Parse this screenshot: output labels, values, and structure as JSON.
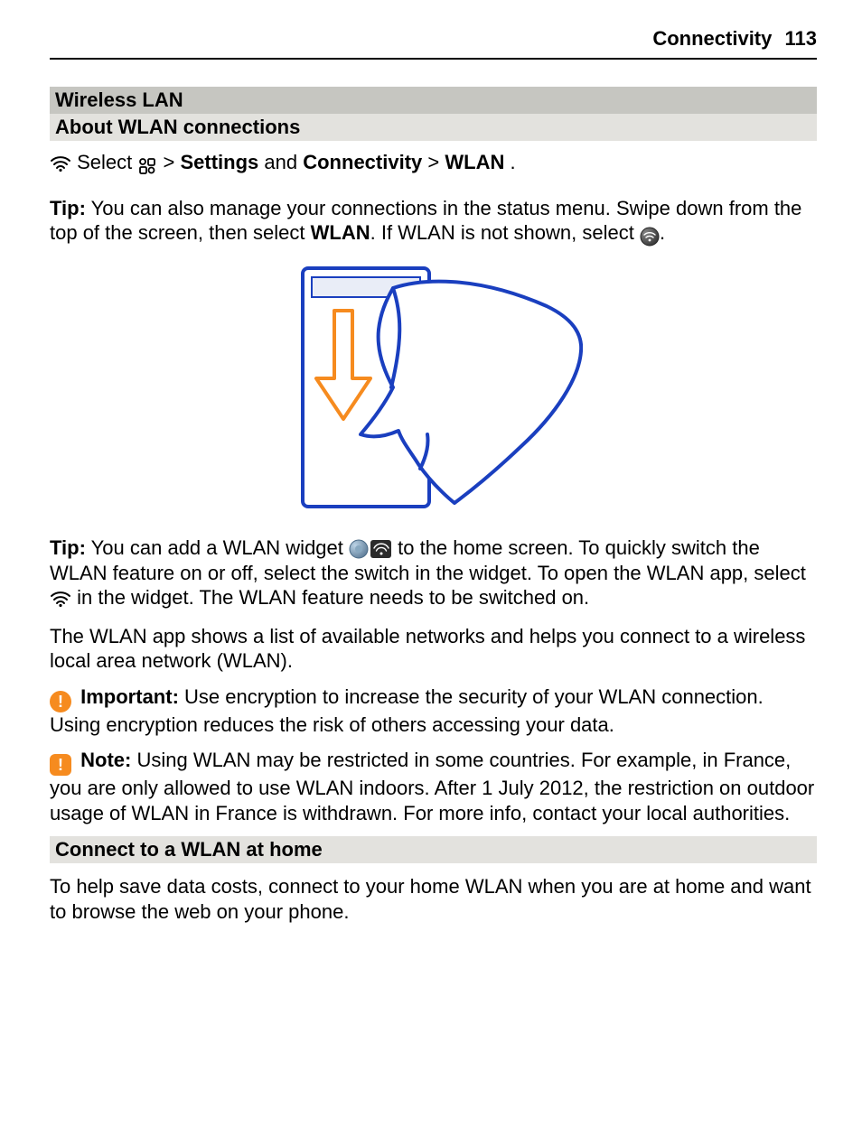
{
  "header": {
    "title": "Connectivity",
    "page": "113"
  },
  "sections": {
    "wireless_lan": "Wireless LAN",
    "about_wlan": "About WLAN connections",
    "connect_home": "Connect to a WLAN at home"
  },
  "instruction": {
    "select": "Select ",
    "gt1": " > ",
    "settings": "Settings",
    "and": " and ",
    "connectivity": "Connectivity",
    "gt2": "  > ",
    "wlan": "WLAN",
    "end": "."
  },
  "tip1": {
    "label": "Tip:",
    "text_a": " You can also manage your connections in the status menu. Swipe down from the top of the screen, then select ",
    "wlan": "WLAN",
    "text_b": ". If WLAN is not shown, select ",
    "end": "."
  },
  "tip2": {
    "label": "Tip:",
    "text_a": " You can add a WLAN widget ",
    "text_b": " to the home screen. To quickly switch the WLAN feature on or off, select the switch in the widget. To open the WLAN app, select ",
    "text_c": " in the widget. The WLAN feature needs to be switched on."
  },
  "para_app": "The WLAN app shows a list of available networks and helps you connect to a wireless local area network (WLAN).",
  "important": {
    "label": "Important:",
    "text": " Use encryption to increase the security of your WLAN connection. Using encryption reduces the risk of others accessing your data."
  },
  "note": {
    "label": "Note:",
    "text": " Using WLAN may be restricted in some countries. For example, in France, you are only allowed to use WLAN indoors. After 1 July 2012, the restriction on outdoor usage of WLAN in France is withdrawn. For more info, contact your local authorities."
  },
  "para_home": "To help save data costs, connect to your home WLAN when you are at home and want to browse the web on your phone."
}
